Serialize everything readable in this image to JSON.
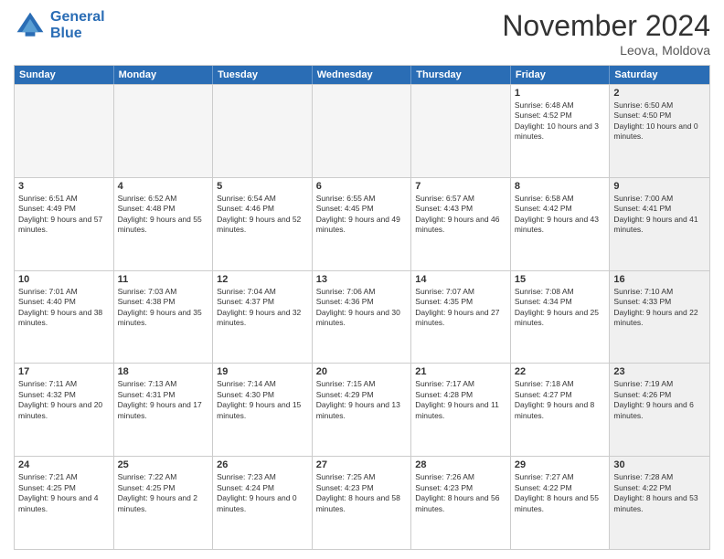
{
  "header": {
    "logo_line1": "General",
    "logo_line2": "Blue",
    "month": "November 2024",
    "location": "Leova, Moldova"
  },
  "weekdays": [
    "Sunday",
    "Monday",
    "Tuesday",
    "Wednesday",
    "Thursday",
    "Friday",
    "Saturday"
  ],
  "rows": [
    [
      {
        "day": "",
        "info": "",
        "empty": true
      },
      {
        "day": "",
        "info": "",
        "empty": true
      },
      {
        "day": "",
        "info": "",
        "empty": true
      },
      {
        "day": "",
        "info": "",
        "empty": true
      },
      {
        "day": "",
        "info": "",
        "empty": true
      },
      {
        "day": "1",
        "info": "Sunrise: 6:48 AM\nSunset: 4:52 PM\nDaylight: 10 hours and 3 minutes.",
        "shaded": false
      },
      {
        "day": "2",
        "info": "Sunrise: 6:50 AM\nSunset: 4:50 PM\nDaylight: 10 hours and 0 minutes.",
        "shaded": true
      }
    ],
    [
      {
        "day": "3",
        "info": "Sunrise: 6:51 AM\nSunset: 4:49 PM\nDaylight: 9 hours and 57 minutes.",
        "shaded": false
      },
      {
        "day": "4",
        "info": "Sunrise: 6:52 AM\nSunset: 4:48 PM\nDaylight: 9 hours and 55 minutes.",
        "shaded": false
      },
      {
        "day": "5",
        "info": "Sunrise: 6:54 AM\nSunset: 4:46 PM\nDaylight: 9 hours and 52 minutes.",
        "shaded": false
      },
      {
        "day": "6",
        "info": "Sunrise: 6:55 AM\nSunset: 4:45 PM\nDaylight: 9 hours and 49 minutes.",
        "shaded": false
      },
      {
        "day": "7",
        "info": "Sunrise: 6:57 AM\nSunset: 4:43 PM\nDaylight: 9 hours and 46 minutes.",
        "shaded": false
      },
      {
        "day": "8",
        "info": "Sunrise: 6:58 AM\nSunset: 4:42 PM\nDaylight: 9 hours and 43 minutes.",
        "shaded": false
      },
      {
        "day": "9",
        "info": "Sunrise: 7:00 AM\nSunset: 4:41 PM\nDaylight: 9 hours and 41 minutes.",
        "shaded": true
      }
    ],
    [
      {
        "day": "10",
        "info": "Sunrise: 7:01 AM\nSunset: 4:40 PM\nDaylight: 9 hours and 38 minutes.",
        "shaded": false
      },
      {
        "day": "11",
        "info": "Sunrise: 7:03 AM\nSunset: 4:38 PM\nDaylight: 9 hours and 35 minutes.",
        "shaded": false
      },
      {
        "day": "12",
        "info": "Sunrise: 7:04 AM\nSunset: 4:37 PM\nDaylight: 9 hours and 32 minutes.",
        "shaded": false
      },
      {
        "day": "13",
        "info": "Sunrise: 7:06 AM\nSunset: 4:36 PM\nDaylight: 9 hours and 30 minutes.",
        "shaded": false
      },
      {
        "day": "14",
        "info": "Sunrise: 7:07 AM\nSunset: 4:35 PM\nDaylight: 9 hours and 27 minutes.",
        "shaded": false
      },
      {
        "day": "15",
        "info": "Sunrise: 7:08 AM\nSunset: 4:34 PM\nDaylight: 9 hours and 25 minutes.",
        "shaded": false
      },
      {
        "day": "16",
        "info": "Sunrise: 7:10 AM\nSunset: 4:33 PM\nDaylight: 9 hours and 22 minutes.",
        "shaded": true
      }
    ],
    [
      {
        "day": "17",
        "info": "Sunrise: 7:11 AM\nSunset: 4:32 PM\nDaylight: 9 hours and 20 minutes.",
        "shaded": false
      },
      {
        "day": "18",
        "info": "Sunrise: 7:13 AM\nSunset: 4:31 PM\nDaylight: 9 hours and 17 minutes.",
        "shaded": false
      },
      {
        "day": "19",
        "info": "Sunrise: 7:14 AM\nSunset: 4:30 PM\nDaylight: 9 hours and 15 minutes.",
        "shaded": false
      },
      {
        "day": "20",
        "info": "Sunrise: 7:15 AM\nSunset: 4:29 PM\nDaylight: 9 hours and 13 minutes.",
        "shaded": false
      },
      {
        "day": "21",
        "info": "Sunrise: 7:17 AM\nSunset: 4:28 PM\nDaylight: 9 hours and 11 minutes.",
        "shaded": false
      },
      {
        "day": "22",
        "info": "Sunrise: 7:18 AM\nSunset: 4:27 PM\nDaylight: 9 hours and 8 minutes.",
        "shaded": false
      },
      {
        "day": "23",
        "info": "Sunrise: 7:19 AM\nSunset: 4:26 PM\nDaylight: 9 hours and 6 minutes.",
        "shaded": true
      }
    ],
    [
      {
        "day": "24",
        "info": "Sunrise: 7:21 AM\nSunset: 4:25 PM\nDaylight: 9 hours and 4 minutes.",
        "shaded": false
      },
      {
        "day": "25",
        "info": "Sunrise: 7:22 AM\nSunset: 4:25 PM\nDaylight: 9 hours and 2 minutes.",
        "shaded": false
      },
      {
        "day": "26",
        "info": "Sunrise: 7:23 AM\nSunset: 4:24 PM\nDaylight: 9 hours and 0 minutes.",
        "shaded": false
      },
      {
        "day": "27",
        "info": "Sunrise: 7:25 AM\nSunset: 4:23 PM\nDaylight: 8 hours and 58 minutes.",
        "shaded": false
      },
      {
        "day": "28",
        "info": "Sunrise: 7:26 AM\nSunset: 4:23 PM\nDaylight: 8 hours and 56 minutes.",
        "shaded": false
      },
      {
        "day": "29",
        "info": "Sunrise: 7:27 AM\nSunset: 4:22 PM\nDaylight: 8 hours and 55 minutes.",
        "shaded": false
      },
      {
        "day": "30",
        "info": "Sunrise: 7:28 AM\nSunset: 4:22 PM\nDaylight: 8 hours and 53 minutes.",
        "shaded": true
      }
    ]
  ]
}
